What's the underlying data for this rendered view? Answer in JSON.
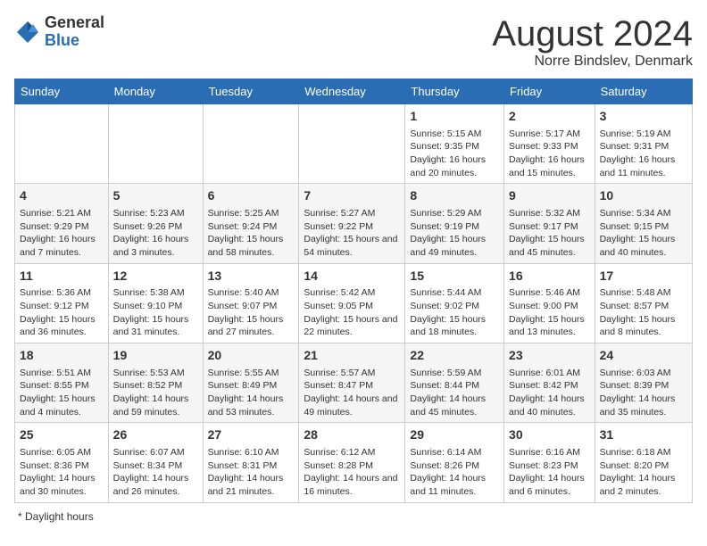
{
  "header": {
    "logo_general": "General",
    "logo_blue": "Blue",
    "month_title": "August 2024",
    "subtitle": "Norre Bindslev, Denmark"
  },
  "days_of_week": [
    "Sunday",
    "Monday",
    "Tuesday",
    "Wednesday",
    "Thursday",
    "Friday",
    "Saturday"
  ],
  "weeks": [
    [
      {
        "day": "",
        "info": ""
      },
      {
        "day": "",
        "info": ""
      },
      {
        "day": "",
        "info": ""
      },
      {
        "day": "",
        "info": ""
      },
      {
        "day": "1",
        "info": "Sunrise: 5:15 AM\nSunset: 9:35 PM\nDaylight: 16 hours and 20 minutes."
      },
      {
        "day": "2",
        "info": "Sunrise: 5:17 AM\nSunset: 9:33 PM\nDaylight: 16 hours and 15 minutes."
      },
      {
        "day": "3",
        "info": "Sunrise: 5:19 AM\nSunset: 9:31 PM\nDaylight: 16 hours and 11 minutes."
      }
    ],
    [
      {
        "day": "4",
        "info": "Sunrise: 5:21 AM\nSunset: 9:29 PM\nDaylight: 16 hours and 7 minutes."
      },
      {
        "day": "5",
        "info": "Sunrise: 5:23 AM\nSunset: 9:26 PM\nDaylight: 16 hours and 3 minutes."
      },
      {
        "day": "6",
        "info": "Sunrise: 5:25 AM\nSunset: 9:24 PM\nDaylight: 15 hours and 58 minutes."
      },
      {
        "day": "7",
        "info": "Sunrise: 5:27 AM\nSunset: 9:22 PM\nDaylight: 15 hours and 54 minutes."
      },
      {
        "day": "8",
        "info": "Sunrise: 5:29 AM\nSunset: 9:19 PM\nDaylight: 15 hours and 49 minutes."
      },
      {
        "day": "9",
        "info": "Sunrise: 5:32 AM\nSunset: 9:17 PM\nDaylight: 15 hours and 45 minutes."
      },
      {
        "day": "10",
        "info": "Sunrise: 5:34 AM\nSunset: 9:15 PM\nDaylight: 15 hours and 40 minutes."
      }
    ],
    [
      {
        "day": "11",
        "info": "Sunrise: 5:36 AM\nSunset: 9:12 PM\nDaylight: 15 hours and 36 minutes."
      },
      {
        "day": "12",
        "info": "Sunrise: 5:38 AM\nSunset: 9:10 PM\nDaylight: 15 hours and 31 minutes."
      },
      {
        "day": "13",
        "info": "Sunrise: 5:40 AM\nSunset: 9:07 PM\nDaylight: 15 hours and 27 minutes."
      },
      {
        "day": "14",
        "info": "Sunrise: 5:42 AM\nSunset: 9:05 PM\nDaylight: 15 hours and 22 minutes."
      },
      {
        "day": "15",
        "info": "Sunrise: 5:44 AM\nSunset: 9:02 PM\nDaylight: 15 hours and 18 minutes."
      },
      {
        "day": "16",
        "info": "Sunrise: 5:46 AM\nSunset: 9:00 PM\nDaylight: 15 hours and 13 minutes."
      },
      {
        "day": "17",
        "info": "Sunrise: 5:48 AM\nSunset: 8:57 PM\nDaylight: 15 hours and 8 minutes."
      }
    ],
    [
      {
        "day": "18",
        "info": "Sunrise: 5:51 AM\nSunset: 8:55 PM\nDaylight: 15 hours and 4 minutes."
      },
      {
        "day": "19",
        "info": "Sunrise: 5:53 AM\nSunset: 8:52 PM\nDaylight: 14 hours and 59 minutes."
      },
      {
        "day": "20",
        "info": "Sunrise: 5:55 AM\nSunset: 8:49 PM\nDaylight: 14 hours and 53 minutes."
      },
      {
        "day": "21",
        "info": "Sunrise: 5:57 AM\nSunset: 8:47 PM\nDaylight: 14 hours and 49 minutes."
      },
      {
        "day": "22",
        "info": "Sunrise: 5:59 AM\nSunset: 8:44 PM\nDaylight: 14 hours and 45 minutes."
      },
      {
        "day": "23",
        "info": "Sunrise: 6:01 AM\nSunset: 8:42 PM\nDaylight: 14 hours and 40 minutes."
      },
      {
        "day": "24",
        "info": "Sunrise: 6:03 AM\nSunset: 8:39 PM\nDaylight: 14 hours and 35 minutes."
      }
    ],
    [
      {
        "day": "25",
        "info": "Sunrise: 6:05 AM\nSunset: 8:36 PM\nDaylight: 14 hours and 30 minutes."
      },
      {
        "day": "26",
        "info": "Sunrise: 6:07 AM\nSunset: 8:34 PM\nDaylight: 14 hours and 26 minutes."
      },
      {
        "day": "27",
        "info": "Sunrise: 6:10 AM\nSunset: 8:31 PM\nDaylight: 14 hours and 21 minutes."
      },
      {
        "day": "28",
        "info": "Sunrise: 6:12 AM\nSunset: 8:28 PM\nDaylight: 14 hours and 16 minutes."
      },
      {
        "day": "29",
        "info": "Sunrise: 6:14 AM\nSunset: 8:26 PM\nDaylight: 14 hours and 11 minutes."
      },
      {
        "day": "30",
        "info": "Sunrise: 6:16 AM\nSunset: 8:23 PM\nDaylight: 14 hours and 6 minutes."
      },
      {
        "day": "31",
        "info": "Sunrise: 6:18 AM\nSunset: 8:20 PM\nDaylight: 14 hours and 2 minutes."
      }
    ]
  ],
  "footer": {
    "note": "Daylight hours"
  }
}
